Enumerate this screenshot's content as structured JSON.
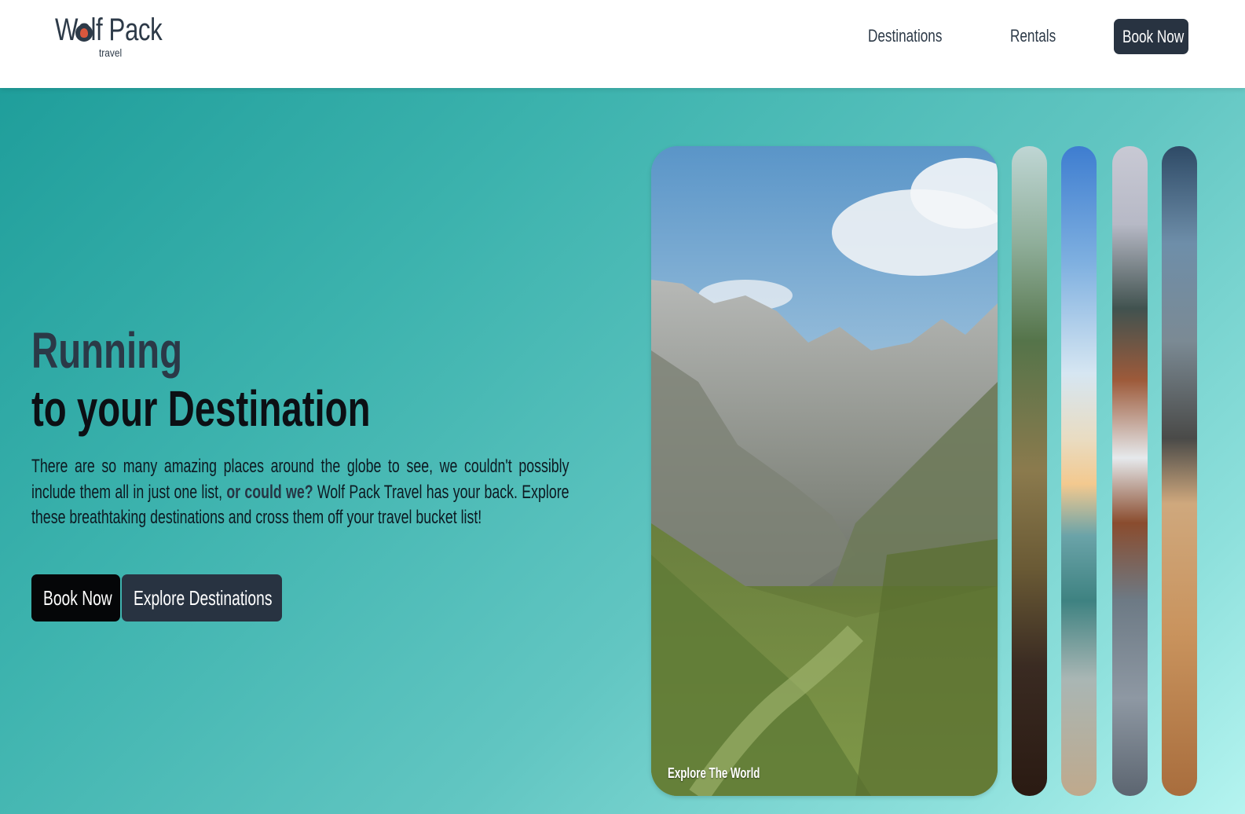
{
  "header": {
    "logo": {
      "name": "Wolf Pack",
      "sub": "travel"
    },
    "nav": [
      {
        "label": "Destinations"
      },
      {
        "label": "Rentals"
      }
    ],
    "cta_label": "Book Now"
  },
  "hero": {
    "title_line1": "Running",
    "title_line2": "to your Destination",
    "text_before": "There are so many amazing places around the globe to see, we couldn't possibly include them all in just one list, ",
    "text_bold": "or could we?",
    "text_after": " Wolf Pack Travel has your back. Explore these breathtaking destinations and cross them off your travel bucket list!",
    "buttons": {
      "book": "Book Now",
      "explore": "Explore Destinations"
    }
  },
  "gallery": {
    "active": {
      "caption": "Explore The World",
      "scene": "mountain-valley"
    },
    "strips": [
      {
        "scene": "forest"
      },
      {
        "scene": "beach"
      },
      {
        "scene": "snow-cabin"
      },
      {
        "scene": "desert"
      }
    ]
  },
  "colors": {
    "brand_dark": "#283341",
    "button_black": "#050608",
    "gradient_start": "#1f9e9b",
    "gradient_end": "#b5f4f0"
  }
}
